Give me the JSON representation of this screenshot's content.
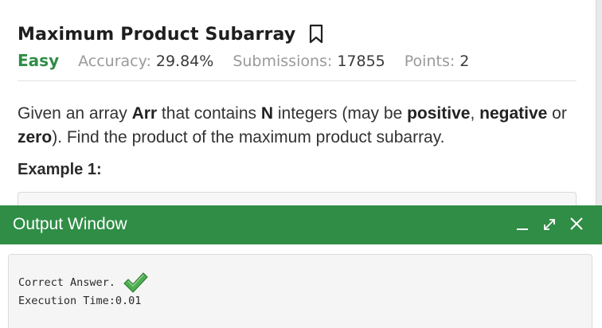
{
  "problem": {
    "title": "Maximum Product Subarray",
    "difficulty": "Easy",
    "accuracy_label": "Accuracy:",
    "accuracy_value": "29.84%",
    "submissions_label": "Submissions:",
    "submissions_value": "17855",
    "points_label": "Points:",
    "points_value": "2",
    "description": {
      "t1": "Given an array ",
      "arr": "Arr",
      "t2": " that contains ",
      "n": "N",
      "t3": " integers (may be ",
      "positive": "positive",
      "t4": ", ",
      "negative": "negative",
      "t5": " or ",
      "zero": "zero",
      "t6": "). Find the product of the maximum product subarray."
    },
    "example_heading": "Example 1:"
  },
  "output_window": {
    "title": "Output Window",
    "result_text": "Correct Answer.",
    "execution_text": "Execution Time:0.01"
  },
  "colors": {
    "accent_green": "#2f8d46",
    "check_green": "#4caf50"
  },
  "icons": {
    "bookmark": "bookmark-icon",
    "minimize": "minimize-icon",
    "expand": "expand-icon",
    "close": "close-icon",
    "check": "checkmark-icon"
  }
}
